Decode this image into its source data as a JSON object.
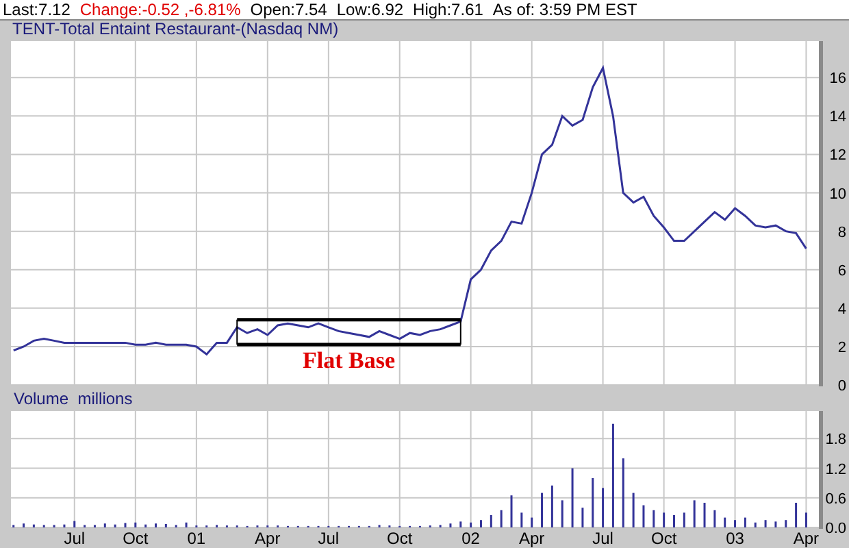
{
  "quote": {
    "last": "Last:7.12",
    "change": "Change:-0.52 ,-6.81%",
    "open": "Open:7.54",
    "low": "Low:6.92",
    "high": "High:7.61",
    "as_of": "As of: 3:59 PM EST"
  },
  "price_panel": {
    "title": "TENT-Total Entaint Restaurant-(Nasdaq NM)",
    "chart_data": {
      "type": "line",
      "grid": true,
      "categories": [
        null,
        null,
        null,
        null,
        null,
        null,
        null,
        null,
        null,
        null,
        null,
        null,
        null,
        null,
        null,
        null,
        null,
        null,
        null,
        null,
        null,
        null,
        null,
        null,
        null,
        null,
        null,
        null,
        null,
        null,
        null,
        null,
        null,
        null,
        null,
        null,
        null,
        null,
        null,
        null,
        null,
        null,
        null,
        null,
        null,
        null,
        null,
        null,
        null,
        null,
        null,
        null,
        null,
        null,
        null,
        null,
        null,
        null,
        null,
        null,
        null,
        null,
        null,
        null,
        null,
        null,
        null,
        null,
        null,
        null,
        null,
        null,
        null,
        null,
        null,
        null,
        null,
        null,
        null
      ],
      "series": [
        {
          "color": "#333399",
          "values": [
            1.8,
            2.0,
            2.3,
            2.4,
            2.3,
            2.2,
            2.2,
            2.2,
            2.2,
            2.2,
            2.2,
            2.2,
            2.1,
            2.1,
            2.2,
            2.1,
            2.1,
            2.1,
            2.0,
            1.6,
            2.2,
            2.2,
            3.0,
            2.7,
            2.9,
            2.6,
            3.1,
            3.2,
            3.1,
            3.0,
            3.2,
            3.0,
            2.8,
            2.7,
            2.6,
            2.5,
            2.8,
            2.6,
            2.4,
            2.7,
            2.6,
            2.8,
            2.9,
            3.1,
            3.3,
            5.5,
            6.0,
            7.0,
            7.5,
            8.5,
            8.4,
            10,
            12,
            12.5,
            14,
            13.5,
            13.8,
            15.5,
            16.5,
            14,
            10,
            9.5,
            9.8,
            8.8,
            8.2,
            7.5,
            7.5,
            8.0,
            8.5,
            9.0,
            8.6,
            9.2,
            8.8,
            8.3,
            8.2,
            8.3,
            8.0,
            7.9,
            7.1
          ]
        }
      ],
      "ylim": [
        0,
        17.9
      ],
      "yticks": [
        0,
        2,
        4,
        6,
        8,
        10,
        12,
        14,
        16
      ],
      "annotations": [
        "Flat Base"
      ]
    }
  },
  "volume_panel": {
    "title": "Volume  millions",
    "chart_data": {
      "type": "bar",
      "grid": true,
      "categories": [
        null,
        null,
        null,
        null,
        null,
        null,
        "Jul",
        null,
        null,
        null,
        null,
        null,
        "Oct",
        null,
        null,
        null,
        null,
        null,
        "01",
        null,
        null,
        null,
        null,
        null,
        null,
        "Apr",
        null,
        null,
        null,
        null,
        null,
        "Jul",
        null,
        null,
        null,
        null,
        null,
        null,
        "Oct",
        null,
        null,
        null,
        null,
        null,
        null,
        "02",
        null,
        null,
        null,
        null,
        null,
        "Apr",
        null,
        null,
        null,
        null,
        null,
        null,
        "Jul",
        null,
        null,
        null,
        null,
        null,
        "Oct",
        null,
        null,
        null,
        null,
        null,
        null,
        "03",
        null,
        null,
        null,
        null,
        null,
        null,
        "Apr"
      ],
      "series": [
        {
          "color": "#333399",
          "values": [
            0.05,
            0.08,
            0.06,
            0.05,
            0.05,
            0.06,
            0.13,
            0.05,
            0.05,
            0.08,
            0.06,
            0.09,
            0.1,
            0.06,
            0.08,
            0.07,
            0.05,
            0.1,
            0.04,
            0.04,
            0.05,
            0.04,
            0.04,
            0.03,
            0.04,
            0.04,
            0.04,
            0.03,
            0.03,
            0.03,
            0.03,
            0.03,
            0.03,
            0.03,
            0.03,
            0.03,
            0.05,
            0.04,
            0.03,
            0.03,
            0.03,
            0.04,
            0.05,
            0.08,
            0.12,
            0.1,
            0.15,
            0.25,
            0.35,
            0.65,
            0.3,
            0.2,
            0.7,
            0.85,
            0.55,
            1.2,
            0.4,
            1.0,
            0.8,
            2.1,
            1.4,
            0.7,
            0.45,
            0.35,
            0.3,
            0.25,
            0.3,
            0.55,
            0.5,
            0.35,
            0.2,
            0.15,
            0.2,
            0.1,
            0.15,
            0.12,
            0.15,
            0.5,
            0.3
          ]
        }
      ],
      "ylim": [
        0,
        2.36
      ],
      "yticks": [
        {
          "value": 0,
          "label": "0.0"
        },
        {
          "value": 0.6,
          "label": "0.6"
        },
        {
          "value": 1.2,
          "label": "1.2"
        },
        {
          "value": 1.8,
          "label": "1.8"
        }
      ]
    }
  }
}
